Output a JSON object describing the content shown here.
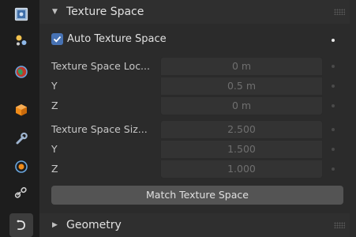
{
  "tabs": [
    {
      "name": "render-tab",
      "icon": "render-icon"
    },
    {
      "name": "scene-tab",
      "icon": "scene-icon"
    },
    {
      "name": "world-tab",
      "icon": "world-icon"
    },
    {
      "name": "object-tab",
      "icon": "object-icon"
    },
    {
      "name": "modifier-tab",
      "icon": "wrench-icon"
    },
    {
      "name": "physics-tab",
      "icon": "physics-icon"
    },
    {
      "name": "constraint-tab",
      "icon": "constraint-icon"
    },
    {
      "name": "data-tab",
      "icon": "curve-data-icon",
      "active": true
    }
  ],
  "texture_space": {
    "title": "Texture Space",
    "auto_texture_space_label": "Auto Texture Space",
    "auto_texture_space_checked": true,
    "location_label": "Texture Space Loc...",
    "location": {
      "x": "0 m",
      "y": "0.5 m",
      "z": "0 m"
    },
    "size_label": "Texture Space Siz...",
    "size": {
      "x": "2.500",
      "y": "1.500",
      "z": "1.000"
    },
    "y_label": "Y",
    "z_label": "Z",
    "match_button": "Match Texture Space"
  },
  "geometry": {
    "title": "Geometry"
  },
  "colors": {
    "accent": "#4772b3",
    "panel": "#2b2b2b",
    "button": "#545454"
  }
}
